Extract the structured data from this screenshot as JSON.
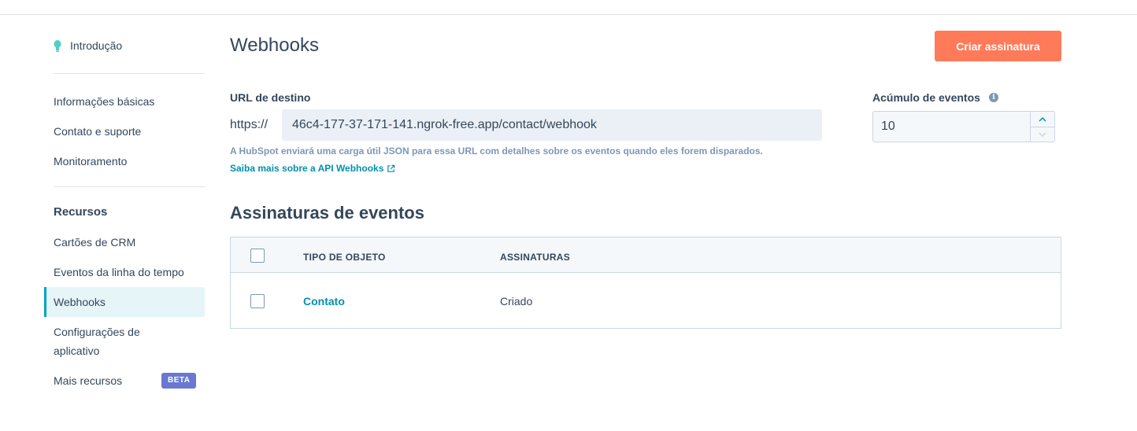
{
  "sidebar": {
    "intro_label": "Introdução",
    "items_top": [
      {
        "label": "Informações básicas"
      },
      {
        "label": "Contato e suporte"
      },
      {
        "label": "Monitoramento"
      }
    ],
    "resources_heading": "Recursos",
    "items_resources": [
      {
        "label": "Cartões de CRM"
      },
      {
        "label": "Eventos da linha do tempo"
      },
      {
        "label": "Webhooks"
      },
      {
        "label": "Configurações de aplicativo"
      },
      {
        "label": "Mais recursos"
      }
    ],
    "beta_badge": "BETA",
    "active_item": "Webhooks"
  },
  "header": {
    "title": "Webhooks",
    "create_button": "Criar assinatura"
  },
  "target_url": {
    "label": "URL de destino",
    "prefix": "https://",
    "value": "46c4-177-37-171-141.ngrok-free.app/contact/webhook",
    "help_text": "A HubSpot enviará uma carga útil JSON para essa URL com detalhes sobre os eventos quando eles forem disparados.",
    "learn_more_link": "Saiba mais sobre a API Webhooks"
  },
  "event_batching": {
    "label": "Acúmulo de eventos",
    "value": "10"
  },
  "subscriptions": {
    "title": "Assinaturas de eventos",
    "columns": [
      "TIPO DE OBJETO",
      "ASSINATURAS"
    ],
    "rows": [
      {
        "object_type": "Contato",
        "subscriptions": "Criado"
      }
    ]
  },
  "colors": {
    "accent_orange": "#ff7a59",
    "link_teal": "#0091ae",
    "active_bar": "#00a4bd",
    "beta_badge": "#6a78d1"
  }
}
